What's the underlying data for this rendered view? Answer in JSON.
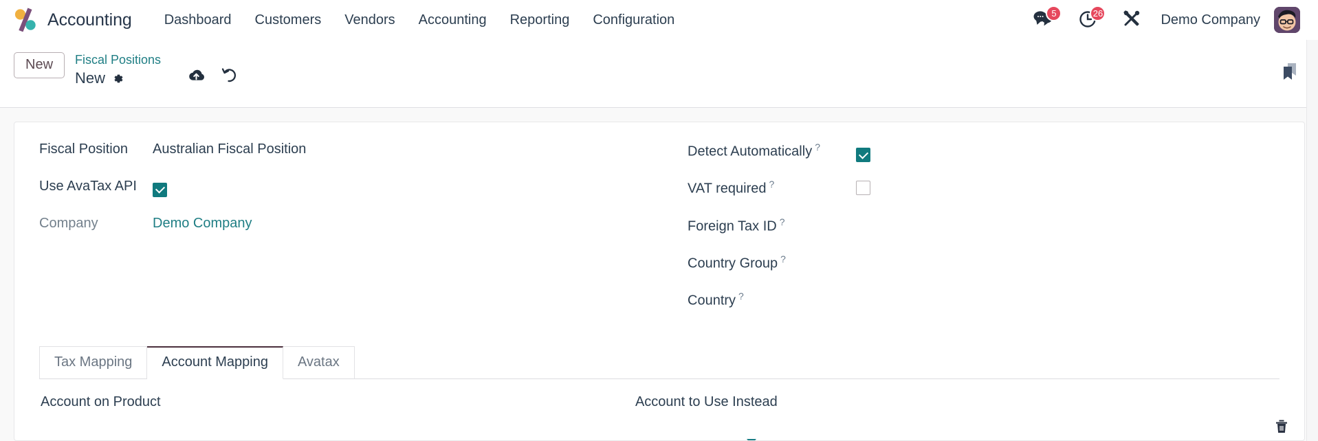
{
  "navbar": {
    "brand": "Accounting",
    "logo_icon": "odoo-percent-logo",
    "menu": [
      {
        "label": "Dashboard"
      },
      {
        "label": "Customers"
      },
      {
        "label": "Vendors"
      },
      {
        "label": "Accounting"
      },
      {
        "label": "Reporting"
      },
      {
        "label": "Configuration"
      }
    ],
    "messages": {
      "icon": "chat-bubbles-icon",
      "count": "5"
    },
    "activities": {
      "icon": "clock-activity-icon",
      "count": "26"
    },
    "apps_tools": {
      "icon": "tools-cross-icon"
    },
    "company": "Demo Company",
    "avatar_icon": "user-avatar"
  },
  "control_panel": {
    "new_button": "New",
    "breadcrumb_parent": "Fiscal Positions",
    "breadcrumb_current": "New",
    "settings_icon": "gear-icon",
    "save_icon": "cloud-upload-save-icon",
    "discard_icon": "undo-discard-icon",
    "bookmark_icon": "bookmark-icon"
  },
  "form": {
    "left": {
      "fiscal_position_label": "Fiscal Position",
      "fiscal_position_value": "Australian Fiscal Position",
      "use_avatax_label": "Use AvaTax API",
      "use_avatax_checked": true,
      "company_label": "Company",
      "company_value": "Demo Company"
    },
    "right": {
      "detect_automatically_label": "Detect Automatically",
      "detect_automatically_checked": true,
      "vat_required_label": "VAT required",
      "vat_required_checked": false,
      "foreign_tax_id_label": "Foreign Tax ID",
      "foreign_tax_id_value": "",
      "country_group_label": "Country Group",
      "country_group_value": "",
      "country_label": "Country",
      "country_value": "",
      "help_mark": "?"
    }
  },
  "notebook": {
    "tabs": [
      {
        "label": "Tax Mapping",
        "active": false
      },
      {
        "label": "Account Mapping",
        "active": true
      },
      {
        "label": "Avatax",
        "active": false
      }
    ]
  },
  "account_mapping": {
    "columns": [
      "Account on Product",
      "Account to Use Instead"
    ],
    "rows": [
      {
        "account_on_product": "",
        "account_to_use_instead": "",
        "caret_icon": "dropdown-caret-icon",
        "delete_icon": "trash-icon"
      }
    ]
  },
  "colors": {
    "accent_teal": "#107a7e",
    "link_teal": "#1f7e84",
    "badge_red": "#e6485d",
    "text_dark": "#2c3e50",
    "tab_active_border": "#4a2f3c"
  }
}
